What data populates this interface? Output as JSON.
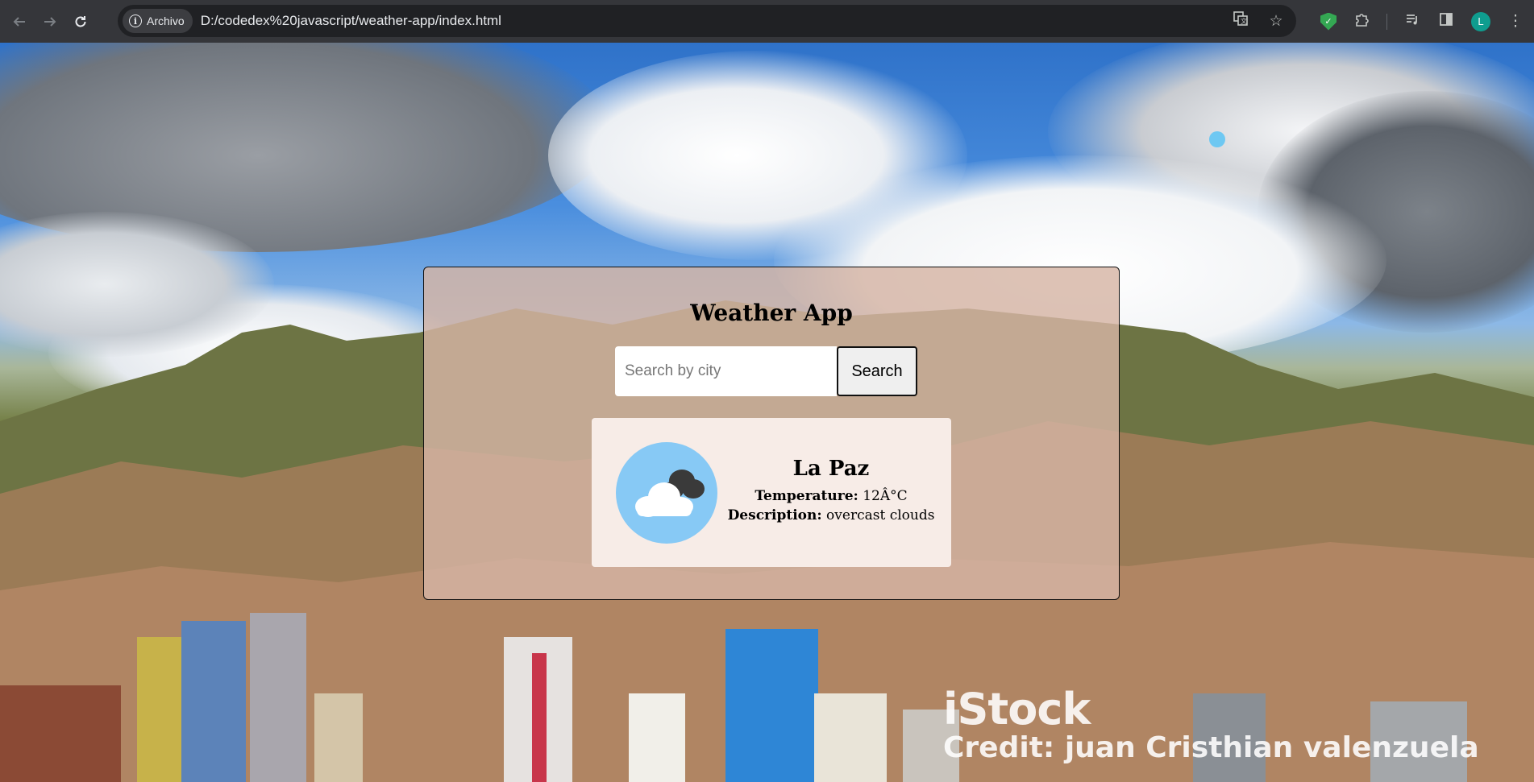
{
  "browser": {
    "site_chip": "Archivo",
    "url": "D:/codedex%20javascript/weather-app/index.html",
    "avatar_letter": "L",
    "icons": [
      "back-icon",
      "forward-icon",
      "reload-icon",
      "info-icon",
      "translate-icon",
      "star-icon",
      "shield-extension-icon",
      "puzzle-extensions-icon",
      "media-queue-icon",
      "side-panel-icon",
      "menu-kebab-icon"
    ]
  },
  "app": {
    "title": "Weather App",
    "search_placeholder": "Search by city",
    "search_button": "Search"
  },
  "result": {
    "city": "La Paz",
    "temperature_label": "Temperature:",
    "temperature_value": "12Â°C",
    "description_label": "Description:",
    "description_value": "overcast clouds",
    "icon": "overcast-clouds-icon"
  },
  "watermark": {
    "logo": "iStock",
    "credit": "Credit: juan Cristhian valenzuela"
  },
  "colors": {
    "chrome": "#35363a",
    "omnibox": "#202124",
    "panel": "#d6b4a5",
    "icon_circle": "#87c9f5",
    "accent_avatar": "#0f9d8f"
  }
}
